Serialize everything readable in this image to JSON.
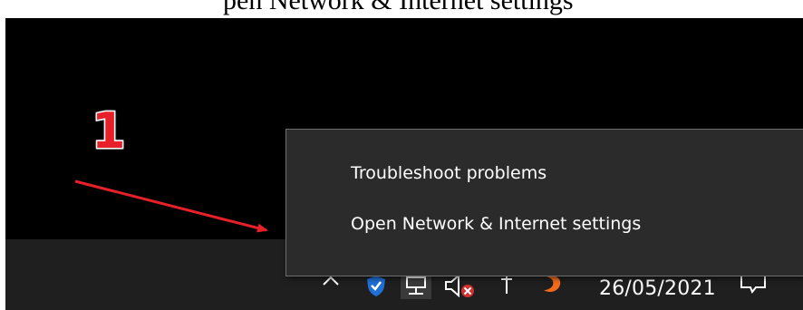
{
  "caption": {
    "text": "pen Network & Internet settings"
  },
  "annotation": {
    "number": "1",
    "color": "#e8202a"
  },
  "context_menu": {
    "items": [
      {
        "label": "Troubleshoot problems"
      },
      {
        "label": "Open Network & Internet settings"
      }
    ]
  },
  "taskbar": {
    "tray_icons": [
      {
        "icon": "chevron-up-icon"
      },
      {
        "icon": "shield-check-icon"
      },
      {
        "icon": "network-icon"
      },
      {
        "icon": "volume-muted-icon"
      },
      {
        "icon": "pen-icon"
      },
      {
        "icon": "app-icon-orange"
      }
    ],
    "date": "26/05/2021",
    "notification_icon": "action-center-icon"
  }
}
